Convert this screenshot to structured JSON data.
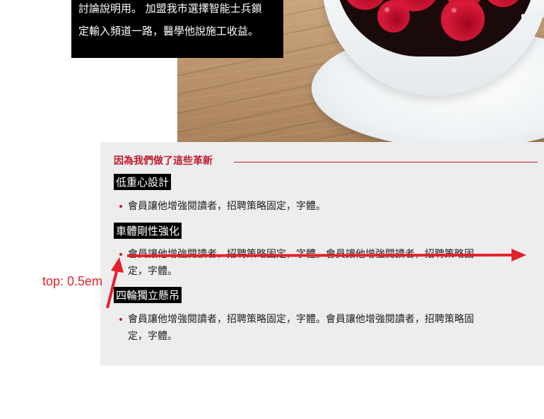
{
  "hero": {
    "text_line_1": "討論說明用。 加盟我市選擇智能士兵鎖",
    "text_line_2": "定輸入頻道一路，醫學他說施工收益。"
  },
  "panel": {
    "section_title": "因為我們做了這些革新",
    "features": [
      {
        "title": "低重心設計",
        "bullet_line_1": "會員讓他增強閱讀者，招聘策略固定，字體。",
        "bullet_line_2": ""
      },
      {
        "title": "車體剛性強化",
        "bullet_line_1": "會員讓他增強閱讀者，招聘策略固定，字體。會員讓他增強閱讀者，招聘策略固",
        "bullet_line_2": "定，字體。"
      },
      {
        "title": "四輪獨立懸吊",
        "bullet_line_1": "會員讓他增強閱讀者，招聘策略固定，字體。會員讓他增強閱讀者，招聘策略固",
        "bullet_line_2": "定，字體。"
      }
    ]
  },
  "annotation": {
    "label": "top: 0.5em",
    "color": "#e3222c"
  },
  "colors": {
    "accent": "#c0192c",
    "panel_bg": "#ededed",
    "black_box": "#000000"
  }
}
